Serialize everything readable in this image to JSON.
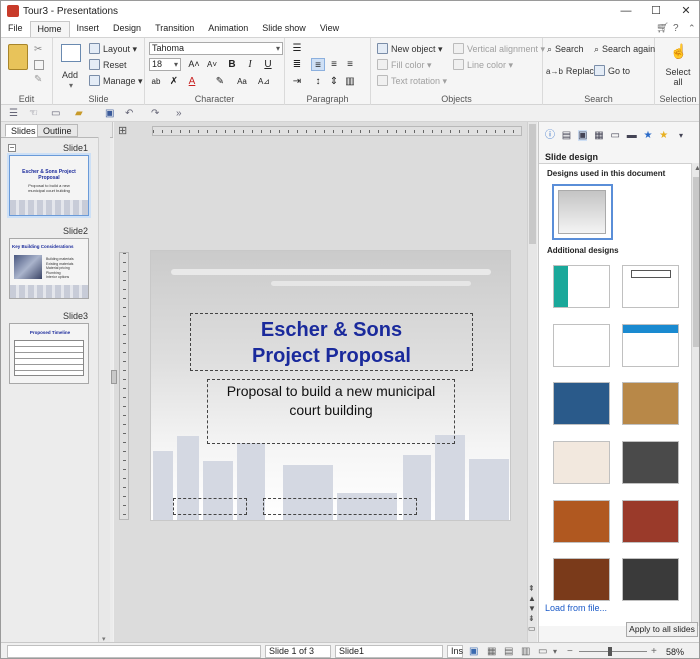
{
  "window": {
    "title": "Tour3 - Presentations",
    "min": "—",
    "max": "☐",
    "close": "✕"
  },
  "menu": {
    "tabs": [
      "File",
      "Home",
      "Insert",
      "Design",
      "Transition",
      "Animation",
      "Slide show",
      "View"
    ],
    "active": "Home"
  },
  "ribbon": {
    "edit": {
      "label": "Edit"
    },
    "slide": {
      "label": "Slide",
      "add": "Add",
      "layout": "Layout",
      "reset": "Reset",
      "manage": "Manage"
    },
    "character": {
      "label": "Character",
      "font": "Tahoma",
      "size": "18"
    },
    "paragraph": {
      "label": "Paragraph"
    },
    "objects": {
      "label": "Objects",
      "new_object": "New object",
      "fill_color": "Fill color",
      "text_rotation": "Text rotation",
      "vertical_alignment": "Vertical alignment",
      "line_color": "Line color"
    },
    "search": {
      "label": "Search",
      "search": "Search",
      "search_again": "Search again",
      "replace": "Replace",
      "go_to": "Go to"
    },
    "selection": {
      "label": "Selection",
      "select_all": "Select all"
    }
  },
  "left_panel": {
    "tabs": [
      "Slides",
      "Outline"
    ],
    "slides": [
      {
        "label": "Slide1",
        "title": "Escher & Sons Project Proposal",
        "subtitle": "Proposal to build a new municipal court building"
      },
      {
        "label": "Slide2",
        "title": "Key Building Considerations",
        "bullets": [
          "Building materials",
          "Existing materials",
          "Material pricing",
          "Plumbing",
          "Interior options"
        ]
      },
      {
        "label": "Slide3",
        "title": "Proposed Timeline"
      }
    ]
  },
  "slide": {
    "title_line1": "Escher & Sons",
    "title_line2": "Project Proposal",
    "subtitle_line1": "Proposal to build a new municipal",
    "subtitle_line2": "court building"
  },
  "right_panel": {
    "header": "Slide design",
    "used_heading": "Designs used in this document",
    "additional_heading": "Additional designs",
    "load_link": "Load from file...",
    "apply_button": "Apply to all slides"
  },
  "status": {
    "slide_pos": "Slide 1 of 3",
    "slide_name": "Slide1",
    "mode": "Ins",
    "zoom": "58%"
  },
  "colors": {
    "title_blue": "#1a2a9c",
    "accent_red": "#c83b2a",
    "selection_blue": "#6a9ad8"
  }
}
